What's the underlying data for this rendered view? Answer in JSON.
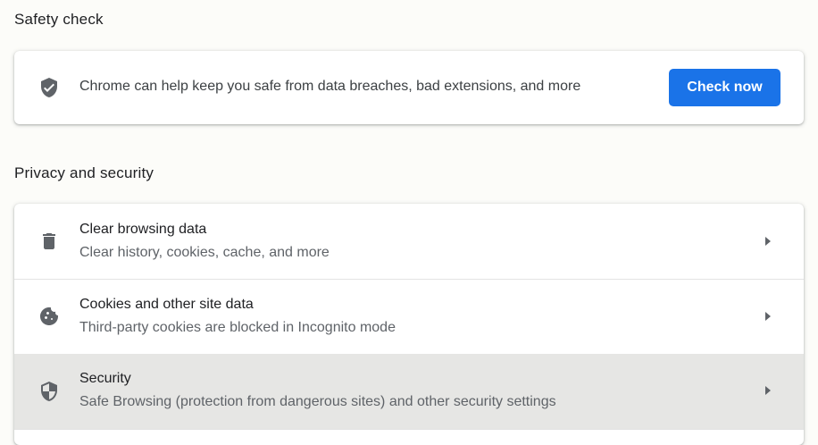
{
  "safety_check": {
    "heading": "Safety check",
    "description": "Chrome can help keep you safe from data breaches, bad extensions, and more",
    "button_label": "Check now",
    "icon": "shield-check-icon"
  },
  "privacy_security": {
    "heading": "Privacy and security",
    "items": [
      {
        "title": "Clear browsing data",
        "subtitle": "Clear history, cookies, cache, and more",
        "icon": "trash-icon"
      },
      {
        "title": "Cookies and other site data",
        "subtitle": "Third-party cookies are blocked in Incognito mode",
        "icon": "cookie-icon"
      },
      {
        "title": "Security",
        "subtitle": "Safe Browsing (protection from dangerous sites) and other security settings",
        "icon": "shield-icon",
        "highlighted": true
      }
    ]
  },
  "colors": {
    "accent": "#1a73e8",
    "page_background": "#fcfcf9",
    "highlight_row": "#e6e6e4"
  }
}
